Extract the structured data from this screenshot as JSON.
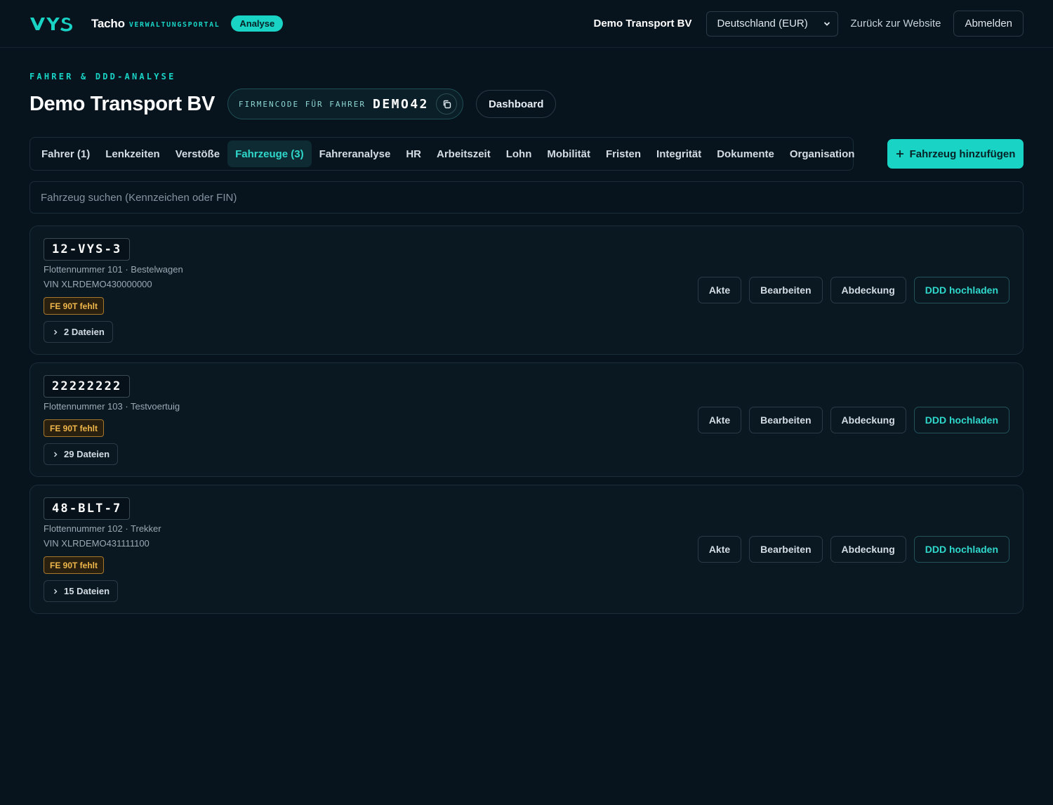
{
  "header": {
    "brand_name": "Tacho",
    "brand_sub": "VERWALTUNGSPORTAL",
    "analyse_badge": "Analyse",
    "company": "Demo Transport BV",
    "country_select": "Deutschland (EUR)",
    "back_link": "Zurück zur Website",
    "logout": "Abmelden"
  },
  "page": {
    "eyebrow": "FAHRER & DDD-ANALYSE",
    "title": "Demo Transport BV",
    "code_label": "FIRMENCODE FÜR FAHRER",
    "code_value": "DEMO42",
    "dashboard": "Dashboard"
  },
  "tabs": [
    {
      "label": "Fahrer (1)"
    },
    {
      "label": "Lenkzeiten"
    },
    {
      "label": "Verstöße"
    },
    {
      "label": "Fahrzeuge (3)"
    },
    {
      "label": "Fahreranalyse"
    },
    {
      "label": "HR"
    },
    {
      "label": "Arbeitszeit"
    },
    {
      "label": "Lohn"
    },
    {
      "label": "Mobilität"
    },
    {
      "label": "Fristen"
    },
    {
      "label": "Integrität"
    },
    {
      "label": "Dokumente"
    },
    {
      "label": "Organisation"
    }
  ],
  "active_tab": "Fahrzeuge (3)",
  "add_button": "Fahrzeug hinzufügen",
  "search": {
    "placeholder": "Fahrzeug suchen (Kennzeichen oder FIN)",
    "value": ""
  },
  "actions": {
    "file": "Akte",
    "edit": "Bearbeiten",
    "coverage": "Abdeckung",
    "upload": "DDD hochladen"
  },
  "vehicles": [
    {
      "plate": "12-VYS-3",
      "fleet": "Flottennummer 101 · Bestelwagen",
      "vin": "VIN XLRDEMO430000000",
      "warning": "FE 90T fehlt",
      "files": "2 Dateien"
    },
    {
      "plate": "22222222",
      "fleet": "Flottennummer 103 · Testvoertuig",
      "vin": "",
      "warning": "FE 90T fehlt",
      "files": "29 Dateien"
    },
    {
      "plate": "48-BLT-7",
      "fleet": "Flottennummer 102 · Trekker",
      "vin": "VIN XLRDEMO431111100",
      "warning": "FE 90T fehlt",
      "files": "15 Dateien"
    }
  ],
  "colors": {
    "accent": "#19d3c5",
    "background": "#07131d",
    "warning": "#f0b74b"
  }
}
